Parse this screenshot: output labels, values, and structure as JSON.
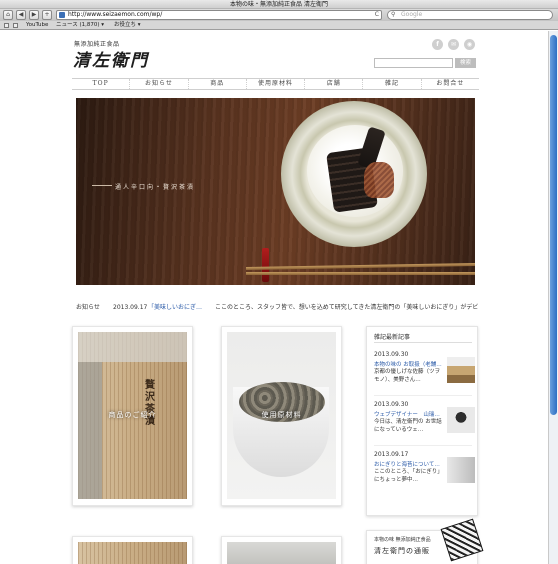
{
  "browser": {
    "window_title": "本物の味・無添加純正食品 清左衛門",
    "url": "http://www.seizaemon.com/wp/",
    "search_placeholder": "Google",
    "nav_back": "◀",
    "nav_forward": "▶",
    "nav_add": "+",
    "reload": "C",
    "bookmarks": [
      "YouTube",
      "ニュース (1,870) ▾",
      "お役立ち ▾"
    ]
  },
  "header": {
    "logo_tagline": "無添加純正食品",
    "logo_name": "清左衛門",
    "social": [
      "f",
      "✉",
      "◉"
    ],
    "search_button": "検索"
  },
  "nav": [
    "TOP",
    "お知らせ",
    "商品",
    "使用原材料",
    "店舗",
    "雑記",
    "お問合せ"
  ],
  "hero": {
    "caption": "通人辛口向・贅沢茶漬"
  },
  "news": {
    "label": "お知らせ",
    "date": "2013.09.17",
    "title": "「美味しいおにぎ…",
    "body": "ここのところ、スタッフ皆で、想いを込めて研究してきた清左衛門の「美味しいおにぎり」がデビュー し…"
  },
  "cards": [
    {
      "label": "商品のご紹介",
      "box_text": "贅沢茶漬"
    },
    {
      "label": "使用原材料"
    }
  ],
  "sidebar": {
    "title": "雑記最新記事",
    "entries": [
      {
        "date": "2013.09.30",
        "link": "本物の味の お取扱（老舗…",
        "text": "京都の優しげな佐藤（ツヲモノ）、美野さん…"
      },
      {
        "date": "2013.09.30",
        "link": "ウェブデザイナー　山瑞…",
        "text": "今日は、清左衛門の お世話になっているウェ…"
      },
      {
        "date": "2013.09.17",
        "link": "おにぎりと海苔について…",
        "text": "ここのところ、「おにぎり」にちょっと夢中…"
      }
    ]
  },
  "banner": {
    "small": "本物の味 無添加純正食品",
    "big": "清左衛門の通販"
  }
}
